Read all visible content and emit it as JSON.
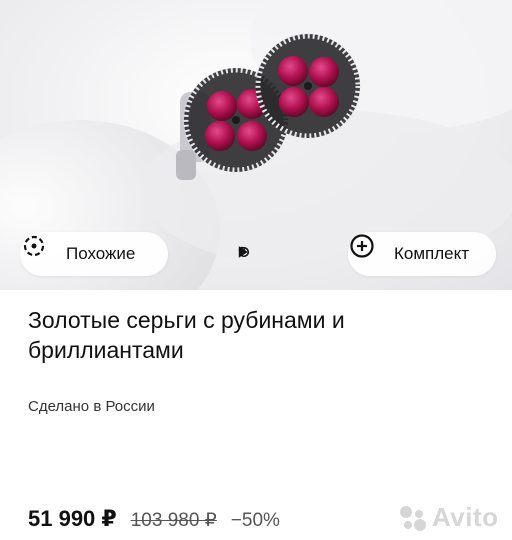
{
  "photo": {
    "alt_subject": "earrings",
    "stone_color": "#b0104f",
    "metal_color": "#c9c9cf"
  },
  "actions": {
    "similar_label": "Похожие",
    "set_label": "Комплект"
  },
  "gallery": {
    "indicators": [
      "play",
      "play-outline",
      "dot",
      "dot",
      "dot-small"
    ]
  },
  "product": {
    "title": "Золотые серьги с рубинами и бриллиантами",
    "origin": "Сделано в России"
  },
  "pricing": {
    "price": "51 990 ₽",
    "old_price": "103 980 ₽",
    "discount": "−50%"
  },
  "watermark": {
    "brand": "Avito"
  }
}
